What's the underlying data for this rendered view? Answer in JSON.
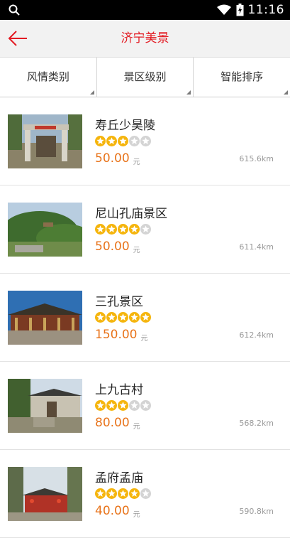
{
  "status": {
    "time": "11:16"
  },
  "header": {
    "title": "济宁美景"
  },
  "filters": [
    {
      "label": "风情类别"
    },
    {
      "label": "景区级别"
    },
    {
      "label": "智能排序"
    }
  ],
  "colors": {
    "accent": "#e31b23",
    "price": "#e8731a",
    "star_on": "#f5b50d",
    "star_off": "#d4d4d4"
  },
  "items": [
    {
      "name": "寿丘少昊陵",
      "rating": 3,
      "price": "50.00",
      "unit": "元",
      "distance": "615.6km"
    },
    {
      "name": "尼山孔庙景区",
      "rating": 4,
      "price": "50.00",
      "unit": "元",
      "distance": "611.4km"
    },
    {
      "name": "三孔景区",
      "rating": 5,
      "price": "150.00",
      "unit": "元",
      "distance": "612.4km"
    },
    {
      "name": "上九古村",
      "rating": 3,
      "price": "80.00",
      "unit": "元",
      "distance": "568.2km"
    },
    {
      "name": "孟府孟庙",
      "rating": 4,
      "price": "40.00",
      "unit": "元",
      "distance": "590.8km"
    }
  ]
}
